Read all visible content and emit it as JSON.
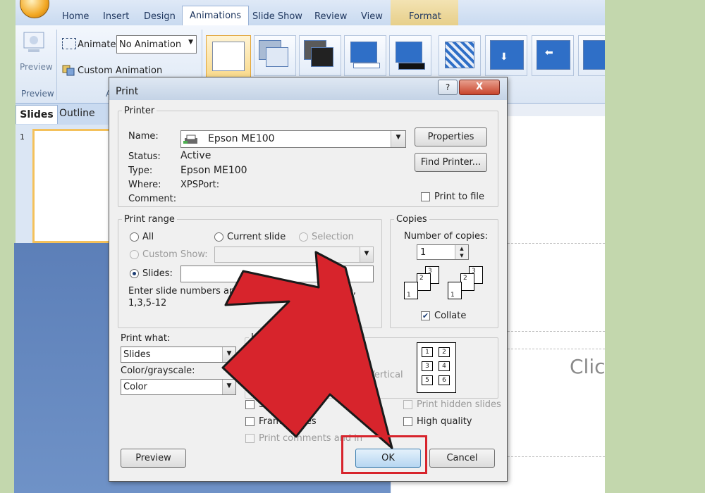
{
  "ribbon": {
    "tabs": [
      "Home",
      "Insert",
      "Design",
      "Animations",
      "Slide Show",
      "Review",
      "View"
    ],
    "active_tab": "Animations",
    "contextual_tab": "Format",
    "preview_label": "Preview",
    "preview_group": "Preview",
    "animate_label": "Animate:",
    "animate_value": "No Animation",
    "custom_animation": "Custom Animation",
    "animations_group_partial": "A"
  },
  "pane_tabs": {
    "slides": "Slides",
    "outline": "Outline"
  },
  "slide_number": "1",
  "canvas": {
    "placeholder_partial": "Clic"
  },
  "dialog": {
    "title": "Print",
    "help": "?",
    "close": "X",
    "printer": {
      "legend": "Printer",
      "name_label": "Name:",
      "name_value": "Epson ME100",
      "status_label": "Status:",
      "status_value": "Active",
      "type_label": "Type:",
      "type_value": "Epson ME100",
      "where_label": "Where:",
      "where_value": "XPSPort:",
      "comment_label": "Comment:",
      "properties_button": "Properties",
      "find_printer_button": "Find Printer...",
      "print_to_file": "Print to file",
      "print_to_file_checked": false
    },
    "print_range": {
      "legend": "Print range",
      "all": "All",
      "current_slide": "Current slide",
      "selection": "Selection",
      "custom_show": "Custom Show:",
      "slides": "Slides:",
      "selected": "Slides",
      "slides_value": "",
      "hint_line1": "Enter slide numbers and",
      "hint_line1_end": "anges. For example,",
      "hint_line2": "1,3,5-12"
    },
    "copies": {
      "legend": "Copies",
      "number_label": "Number of copies:",
      "number_value": "1",
      "collate": "Collate",
      "collate_checked": true,
      "collate_pages": [
        "1",
        "2",
        "3"
      ]
    },
    "print_what": {
      "label": "Print what:",
      "value": "Slides"
    },
    "color": {
      "label": "Color/grayscale:",
      "value": "Color"
    },
    "handouts": {
      "legend_partial": "Ha",
      "slides_partial": "Slid",
      "vertical": "Vertical",
      "grid_numbers": [
        "1",
        "2",
        "3",
        "4",
        "5",
        "6"
      ]
    },
    "options": {
      "scale": "Scale",
      "frame_slides": "Frame slides",
      "print_comments": "Print comments and in",
      "print_comments_end": "p",
      "print_hidden": "Print hidden slides",
      "high_quality": "High quality"
    },
    "buttons": {
      "preview": "Preview",
      "ok": "OK",
      "cancel": "Cancel"
    }
  },
  "colors": {
    "annotation_red": "#d7242c",
    "accent_blue": "#2f6fc7"
  }
}
